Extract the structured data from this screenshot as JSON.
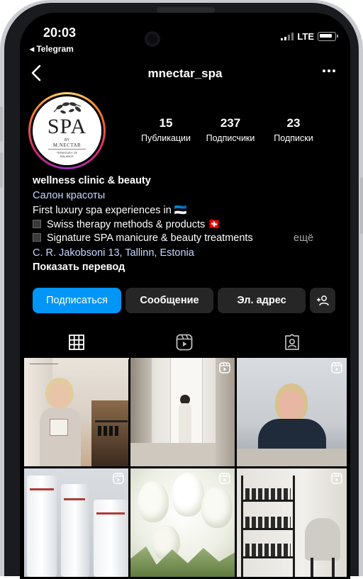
{
  "status_bar": {
    "time": "20:03",
    "back_app": "◂ Telegram",
    "network": "LTE"
  },
  "header": {
    "username": "mnectar_spa",
    "back_icon": "chevron-left-icon",
    "menu_icon": "more-horizontal-icon"
  },
  "avatar": {
    "logo_text": "SPA",
    "logo_by": "BY",
    "logo_brand": "M.NECTAR",
    "logo_tagline1": "TERRITORY OF",
    "logo_tagline2": "BALANCE"
  },
  "stats": [
    {
      "value": "15",
      "label": "Публикации"
    },
    {
      "value": "237",
      "label": "Подписчики"
    },
    {
      "value": "23",
      "label": "Подписки"
    }
  ],
  "bio": {
    "name": "wellness clinic & beauty",
    "category": "Салон красоты",
    "line1": "First luxury spa experiences in 🇪🇪",
    "line2": "Swiss therapy methods & products 🇨🇭",
    "line3": "Signature SPA manicure & beauty treatments",
    "more": "ещё",
    "address": "C. R. Jakobsoni  13, Tallinn, Estonia",
    "translate": "Показать перевод"
  },
  "actions": {
    "follow": "Подписаться",
    "message": "Сообщение",
    "email": "Эл. адрес",
    "add_user_icon": "person-add-icon"
  },
  "tabs": [
    {
      "icon": "grid-icon",
      "active": true
    },
    {
      "icon": "reels-icon",
      "active": false
    },
    {
      "icon": "tagged-icon",
      "active": false
    }
  ],
  "colors": {
    "accent": "#0095f6",
    "button": "#262626",
    "background": "#000000",
    "link": "#c7d7ff"
  }
}
